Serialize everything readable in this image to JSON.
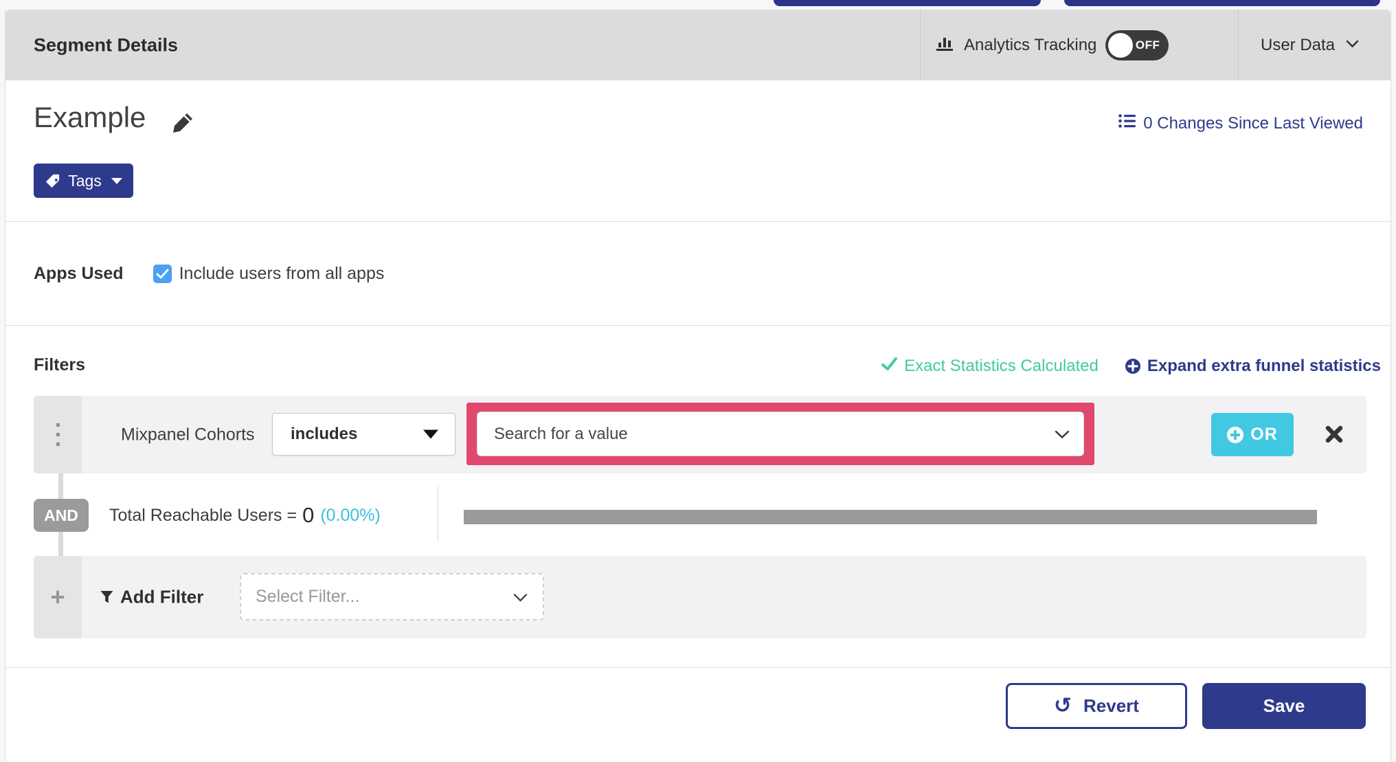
{
  "header": {
    "title": "Segment Details",
    "analytics_tracking_label": "Analytics Tracking",
    "toggle_state": "OFF",
    "toggle_on": false,
    "user_data_label": "User Data"
  },
  "segment": {
    "name": "Example",
    "changes_link": "0 Changes Since Last Viewed",
    "tags_label": "Tags"
  },
  "apps_used": {
    "heading": "Apps Used",
    "checkbox_label": "Include users from all apps",
    "checkbox_checked": true
  },
  "filters": {
    "heading": "Filters",
    "exact_stats_label": "Exact Statistics Calculated",
    "expand_link_label": "Expand extra funnel statistics",
    "row": {
      "field": "Mixpanel Cohorts",
      "operator": "includes",
      "value_placeholder": "Search for a value",
      "or_label": "OR"
    },
    "and_label": "AND",
    "reachable": {
      "label": "Total Reachable Users =",
      "value": "0",
      "percent": "(0.00%)",
      "progress_percent": 0
    },
    "add_filter": {
      "plus": "+",
      "label": "Add Filter",
      "select_placeholder": "Select Filter..."
    }
  },
  "footer": {
    "revert_label": "Revert",
    "save_label": "Save"
  },
  "colors": {
    "indigo_accent": "#2e3a8c",
    "cyan_or_button": "#41c9e2",
    "cyan_percent": "#3cc0d9",
    "teal_success": "#42ca9f",
    "pink_highlight": "#e0486e",
    "checkbox_blue": "#4aa0f5",
    "header_gray": "#dcdcde",
    "row_gray": "#f2f2f4",
    "progress_gray": "#9a9a9a"
  }
}
